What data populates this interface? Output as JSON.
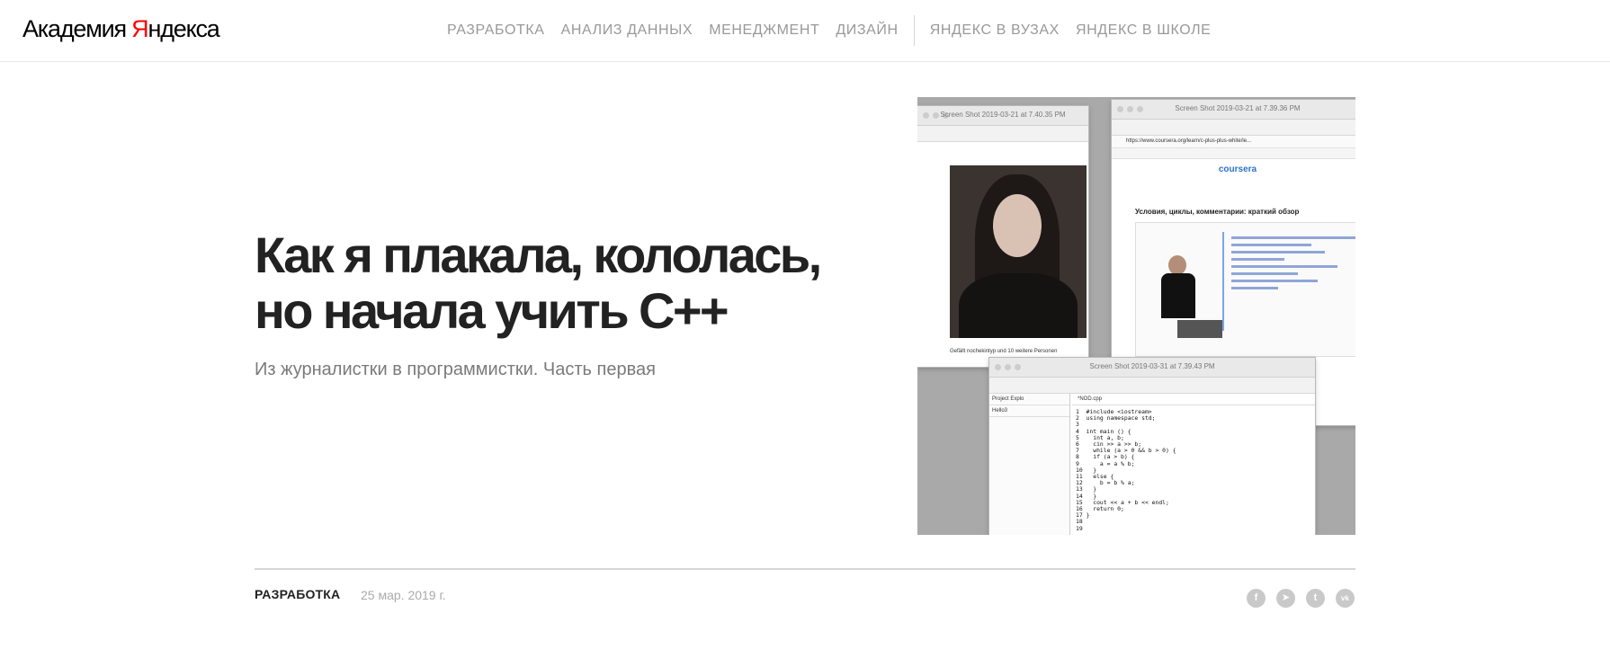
{
  "header": {
    "logo_part1": "Академия ",
    "logo_brand_y": "Я",
    "logo_brand_rest": "ндекса",
    "nav": [
      "РАЗРАБОТКА",
      "АНАЛИЗ ДАННЫХ",
      "МЕНЕДЖМЕНТ",
      "ДИЗАЙН"
    ],
    "nav_secondary": [
      "ЯНДЕКС В ВУЗАХ",
      "ЯНДЕКС В ШКОЛЕ"
    ]
  },
  "article": {
    "title": "Как я плакала, кололась, но начала учить С++",
    "subtitle": "Из журналистки в программистки. Часть первая",
    "category": "РАЗРАБОТКА",
    "date": "25 мар. 2019 г."
  },
  "cover": {
    "win1_title": "Screen Shot 2019-03-21 at 7.40.35 PM",
    "win1_caption": "Gefällt nochekintyp und 10 weitere Personen",
    "win2_title": "Screen Shot 2019-03-21 at 7.39.36 PM",
    "win2_url": "https://www.coursera.org/learn/c-plus-plus-white/le...",
    "win2_brand": "coursera",
    "win2_lesson": "Условия, циклы, комментарии: краткий обзор",
    "win3_title": "Screen Shot 2019-03-31 at 7.39.43 PM",
    "win3_project_tab": "Project Explo",
    "win3_project_item": "Hello3",
    "win3_editor_tab": "*NOD.cpp",
    "win3_code": "1  #include <iostream>\n2  using namespace std;\n3\n4  int main () {\n5    int a, b;\n6    cin >> a >> b;\n7    while (a > 0 && b > 0) {\n8    if (a > b) {\n9      a = a % b;\n10   }\n11   else {\n12     b = b % a;\n13   }\n14   }\n15   cout << a + b << endl;\n16   return 0;\n17 }\n18\n19"
  },
  "share": {
    "icons": [
      "facebook-icon",
      "telegram-icon",
      "twitter-icon",
      "vk-icon"
    ],
    "glyphs": [
      "f",
      "➤",
      "t",
      "vk"
    ]
  }
}
